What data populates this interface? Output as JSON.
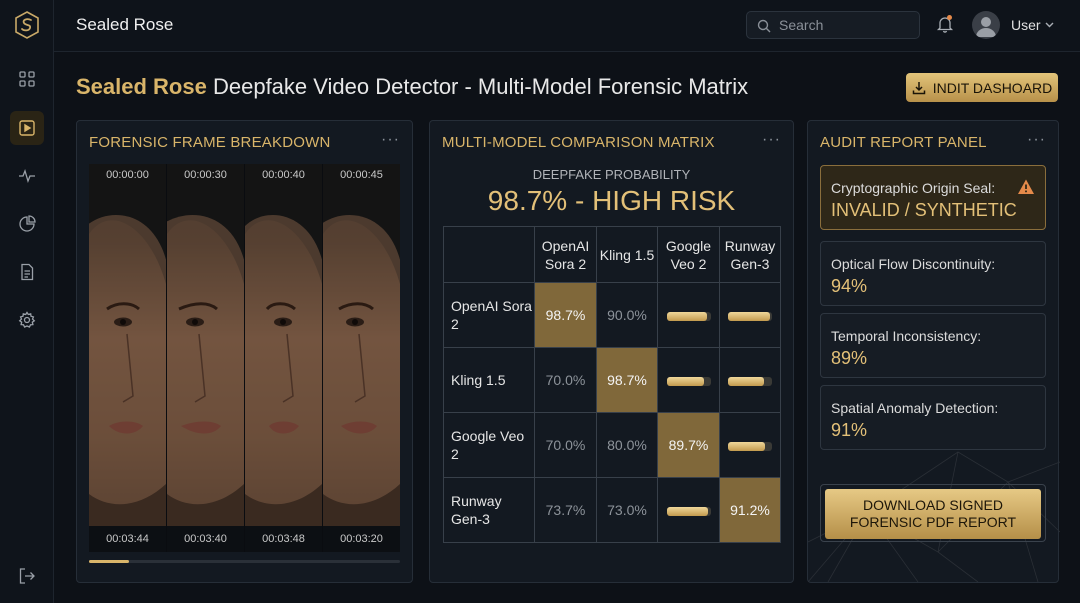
{
  "header": {
    "app_title": "Sealed Rose",
    "search_placeholder": "Search",
    "user_label": "User"
  },
  "sidebar": {
    "items": [
      {
        "icon": "grid-icon"
      },
      {
        "icon": "video-icon",
        "active": true
      },
      {
        "icon": "activity-icon"
      },
      {
        "icon": "pie-chart-icon"
      },
      {
        "icon": "document-icon"
      },
      {
        "icon": "gear-icon"
      }
    ],
    "logout_icon": "logout-icon"
  },
  "page": {
    "title_brand": "Sealed Rose",
    "title_rest": "Deepfake Video Detector - Multi-Model Forensic Matrix",
    "dashboard_button": "INDIT DASHOARD"
  },
  "frame_panel": {
    "title": "FORENSIC FRAME BREAKDOWN",
    "more": "···",
    "frames": [
      {
        "top": "00:00:00",
        "bottom": "00:03:44"
      },
      {
        "top": "00:00:30",
        "bottom": "00:03:40"
      },
      {
        "top": "00:00:40",
        "bottom": "00:03:48"
      },
      {
        "top": "00:00:45",
        "bottom": "00:03:20"
      }
    ],
    "progress": 0.13
  },
  "matrix_panel": {
    "title": "MULTI-MODEL COMPARISON MATRIX",
    "more": "···",
    "prob_label": "DEEPFAKE PROBABILITY",
    "prob_value": "98.7% - HIGH RISK",
    "columns": [
      "OpenAI Sora 2",
      "Kling 1.5",
      "Google Veo 2",
      "Runway Gen-3"
    ],
    "rows": [
      {
        "label": "OpenAI Sora 2",
        "cells": [
          "98.7%",
          "90.0%",
          "",
          ""
        ],
        "bars": [
          null,
          null,
          0.92,
          0.95
        ]
      },
      {
        "label": "Kling 1.5",
        "cells": [
          "70.0%",
          "98.7%",
          "",
          ""
        ],
        "bars": [
          null,
          null,
          0.85,
          0.82
        ]
      },
      {
        "label": "Google Veo 2",
        "cells": [
          "70.0%",
          "80.0%",
          "89.7%",
          ""
        ],
        "bars": [
          null,
          null,
          null,
          0.85
        ]
      },
      {
        "label": "Runway Gen-3",
        "cells": [
          "73.7%",
          "73.0%",
          "",
          "91.2%"
        ],
        "bars": [
          null,
          null,
          0.95,
          null
        ]
      }
    ]
  },
  "audit_panel": {
    "title": "AUDIT REPORT PANEL",
    "more": "···",
    "seal_label": "Cryptographic Origin Seal:",
    "seal_value": "INVALID / SYNTHETIC",
    "metrics": [
      {
        "label": "Optical Flow Discontinuity:",
        "value": "94%"
      },
      {
        "label": "Temporal Inconsistency:",
        "value": "89%"
      },
      {
        "label": "Spatial Anomaly Detection:",
        "value": "91%"
      }
    ],
    "download_line1": "DOWNLOAD SIGNED",
    "download_line2": "FORENSIC PDF REPORT"
  },
  "colors": {
    "accent": "#d9b56a",
    "background": "#0d1117",
    "panel": "#131921",
    "highlight_cell": "#80683a",
    "warning": "#e58a4a"
  }
}
